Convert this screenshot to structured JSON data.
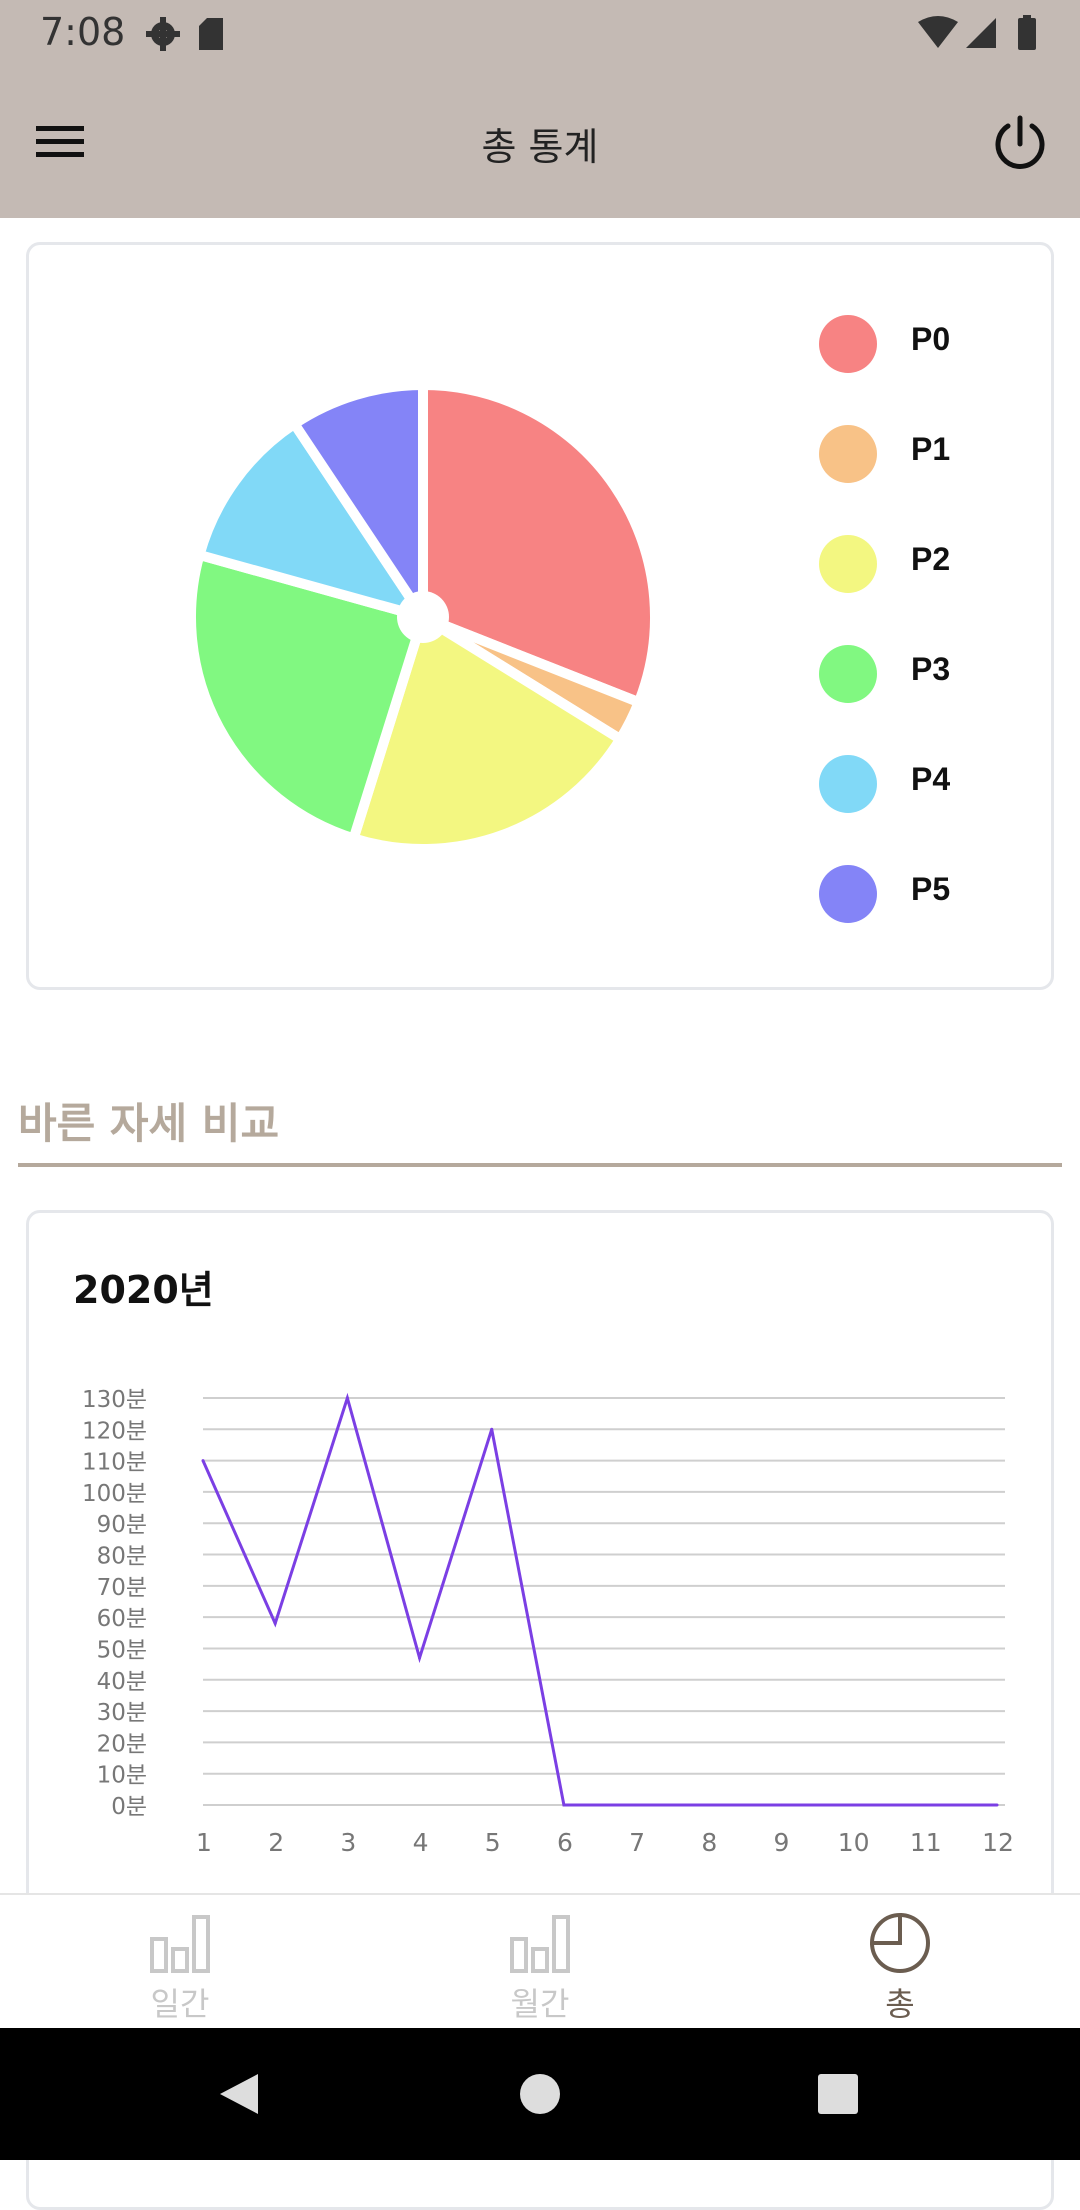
{
  "status": {
    "time": "7:08"
  },
  "app_bar": {
    "title": "총 통계"
  },
  "pie": {
    "legend": [
      {
        "label": "P0",
        "color": "#f78383"
      },
      {
        "label": "P1",
        "color": "#f8c287"
      },
      {
        "label": "P2",
        "color": "#f3f781"
      },
      {
        "label": "P3",
        "color": "#81f881"
      },
      {
        "label": "P4",
        "color": "#81d9f7"
      },
      {
        "label": "P5",
        "color": "#8484f7"
      }
    ]
  },
  "section": {
    "title": "바른 자세 비교"
  },
  "line_card": {
    "year": "2020년"
  },
  "chart_data": [
    {
      "type": "pie",
      "labels": [
        "P0",
        "P1",
        "P2",
        "P3",
        "P4",
        "P5"
      ],
      "values": [
        29.5,
        2.7,
        20.0,
        23.3,
        10.8,
        8.9
      ],
      "colors": [
        "#f78383",
        "#f8c287",
        "#f3f781",
        "#81f881",
        "#81d9f7",
        "#8484f7"
      ],
      "legend_position": "right"
    },
    {
      "type": "line",
      "title": "2020년",
      "x": [
        1,
        2,
        3,
        4,
        5,
        6,
        7,
        8,
        9,
        10,
        11,
        12
      ],
      "y": [
        110,
        58,
        130,
        47,
        120,
        0,
        0,
        0,
        0,
        0,
        0,
        0
      ],
      "ylim": [
        0,
        130
      ],
      "y_ticks": [
        "0분",
        "10분",
        "20분",
        "30분",
        "40분",
        "50분",
        "60분",
        "70분",
        "80분",
        "90분",
        "100분",
        "110분",
        "120분",
        "130분"
      ],
      "x_ticks": [
        "1",
        "2",
        "3",
        "4",
        "5",
        "6",
        "7",
        "8",
        "9",
        "10",
        "11",
        "12"
      ],
      "line_color": "#7b3fe4",
      "grid": true
    }
  ],
  "bottom_nav": {
    "items": [
      {
        "label": "일간",
        "icon": "bar-chart-icon",
        "active": false
      },
      {
        "label": "월간",
        "icon": "bar-chart-icon",
        "active": false
      },
      {
        "label": "총",
        "icon": "pie-chart-icon",
        "active": true
      }
    ],
    "active_color": "#6b5d50",
    "inactive_color": "#c8c8c8"
  }
}
